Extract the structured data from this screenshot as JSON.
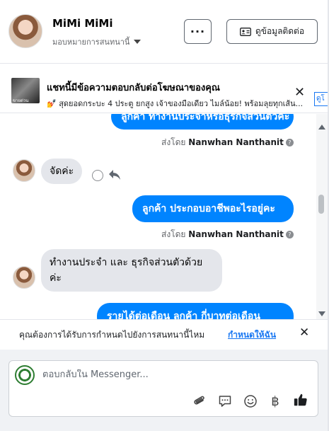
{
  "header": {
    "name": "MiMi MiMi",
    "assign_label": "มอบหมายการสนทนานี้",
    "more_label": "···",
    "contact_info_label": "ดูข้อมูลติดต่อ"
  },
  "ad": {
    "title": "แชทนี้มีข้อความตอบกลับต่อโฆษณาของคุณ",
    "description": "💅 สุดยอดกระบะ 4 ประตู ยกสูง เจ้าของมือเดียว ไมล์น้อย! พร้อมลุยทุกเส้น...",
    "thumb_caption": "ขายด่วน",
    "link_label": "ดูโ"
  },
  "messages": {
    "sent_by_prefix": "ส่งโดย",
    "sender": "Nanwhan Nanthanit",
    "info_glyph": "?",
    "top_partial": "ลูกค้า ทำงานประจำหรือธุรกิจส่วนตัวคะ",
    "incoming_1": "จัดค่ะ",
    "outgoing_1": "ลูกค้า  ประกอบอาชีพอะไรอยู่คะ",
    "incoming_2_line1": "ทำงานประจำ และ ธุรกิจส่วนตัวด้วย",
    "incoming_2_line2": "ค่ะ",
    "outgoing_2": "รายได้ต่อเดือน  ลูกค้า  กี่บาทต่อเดือน"
  },
  "reminder": {
    "text": "คุณต้องการได้รับการกำหนดไปยังการสนทนานี้ไหม",
    "link": "กำหนดให้ฉัน",
    "close": "✕"
  },
  "composer": {
    "placeholder": "ตอบกลับใน Messenger...",
    "tools": [
      "paperclip-icon",
      "saved-reply-icon",
      "emoji-icon",
      "baht-icon",
      "thumbs-up-icon"
    ],
    "baht_glyph": "฿"
  },
  "colors": {
    "accent": "#0084ff",
    "link": "#1877f2",
    "incoming_bubble": "#e4e6eb"
  }
}
